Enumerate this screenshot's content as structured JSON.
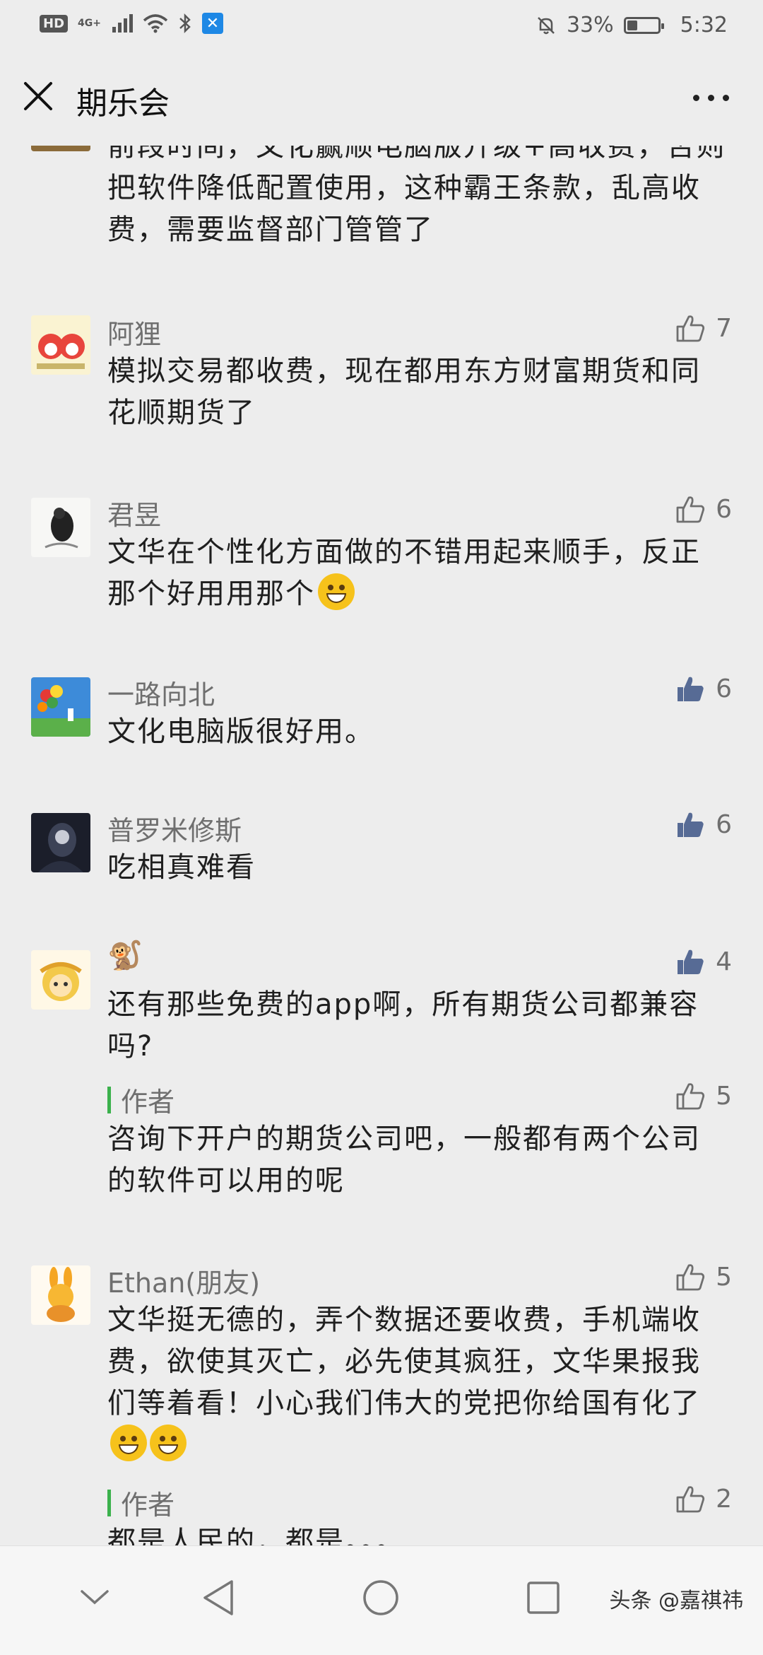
{
  "status_bar": {
    "hd": "HD",
    "network": "4G+",
    "battery_percent": "33%",
    "battery_level": 0.33,
    "time": "5:32"
  },
  "nav": {
    "title": "期乐会",
    "close_icon": "close-icon",
    "more_icon": "more-icon"
  },
  "comments": [
    {
      "text": "前段时间，文化赢顺电脑版升级+高收费，否则把软件降低配置使用，这种霸王条款，乱高收费，需要监督部门管管了"
    },
    {
      "name": "阿狸",
      "likes": "7",
      "liked": false,
      "text": "模拟交易都收费，现在都用东方财富期货和同花顺期货了"
    },
    {
      "name": "君昱",
      "likes": "6",
      "liked": false,
      "text": "文华在个性化方面做的不错用起来顺手，反正那个好用用那个"
    },
    {
      "name": "一路向北",
      "likes": "6",
      "liked": true,
      "text": "文化电脑版很好用。"
    },
    {
      "name": "普罗米修斯",
      "likes": "6",
      "liked": true,
      "text": "吃相真难看"
    },
    {
      "name": "🐒",
      "likes": "4",
      "liked": true,
      "text": "还有那些免费的app啊，所有期货公司都兼容吗?",
      "reply": {
        "label": "作者",
        "likes": "5",
        "text": "咨询下开户的期货公司吧，一般都有两个公司的软件可以用的呢"
      }
    },
    {
      "name": "Ethan(朋友)",
      "likes": "5",
      "liked": false,
      "text": "文华挺无德的，弄个数据还要收费，手机端收费，欲使其灭亡，必先使其疯狂，文华果报我们等着看！小心我们伟大的党把你给国有化了",
      "reply": {
        "label": "作者",
        "likes": "2",
        "text": "都是人民的，都是。。。"
      }
    }
  ],
  "system_nav": {
    "watermark": "头条 @嘉祺祎"
  }
}
